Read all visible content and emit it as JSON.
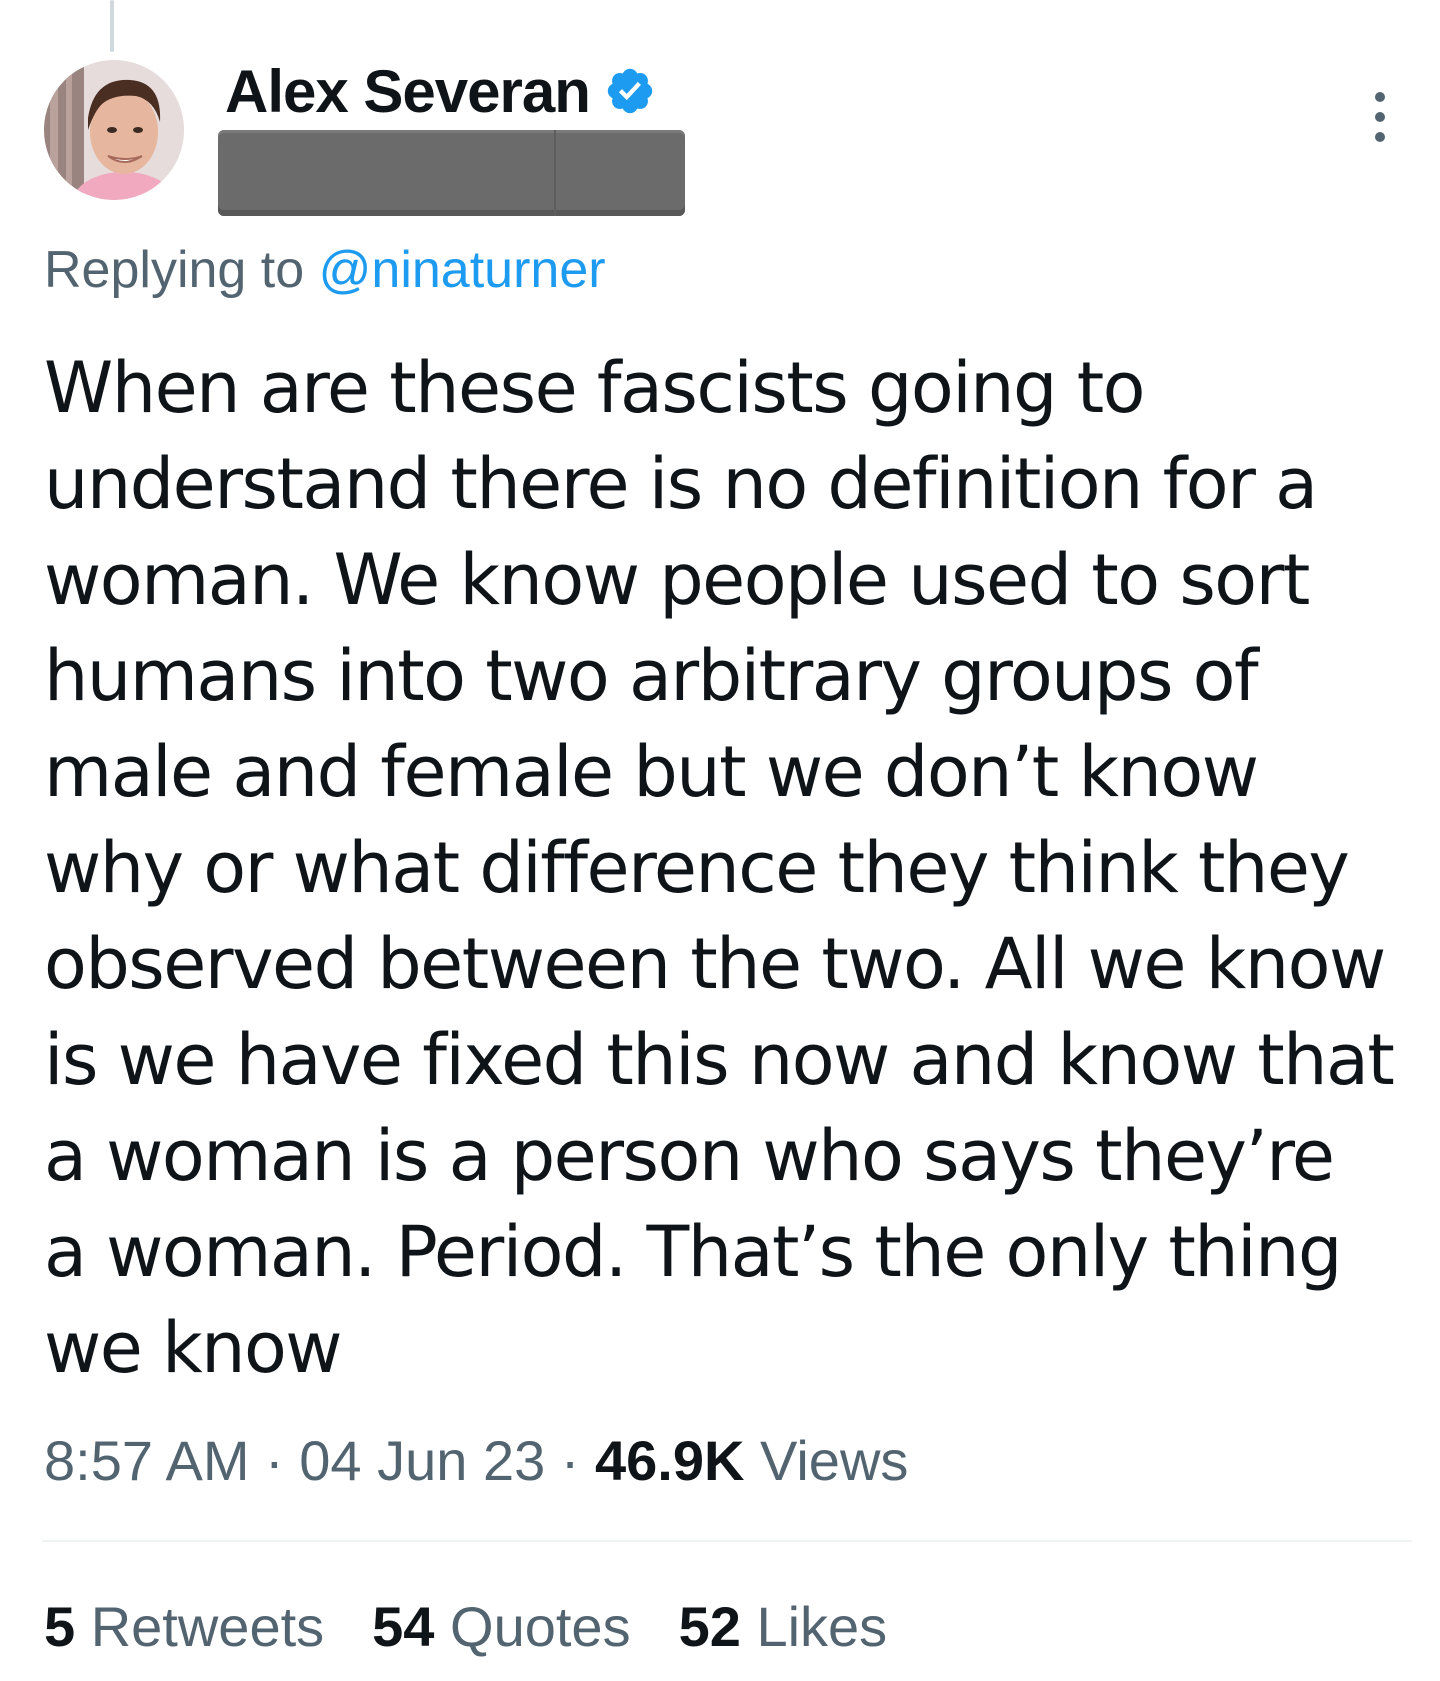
{
  "tweet": {
    "author": {
      "display_name": "Alex Severan",
      "verified": true,
      "handle_redacted": true
    },
    "reply": {
      "prefix": "Replying to",
      "mention": "@ninaturner"
    },
    "text_lines": [
      "When are these fascists going to",
      "understand there is no definition for a",
      "woman.  We know people used to sort",
      "humans into two arbitrary groups of",
      "male and female but we don’t know",
      "why or what difference they think they",
      "observed between the two.  All we know",
      "is we have fixed this now and know that",
      "a woman is a person who says they’re",
      "a woman.  Period.  That’s the only thing",
      "we know"
    ],
    "meta": {
      "time": "8:57 AM",
      "separator": "·",
      "date": "04 Jun 23",
      "views_count": "46.9K",
      "views_label": "Views"
    },
    "stats": {
      "retweets_count": "5",
      "retweets_label": "Retweets",
      "quotes_count": "54",
      "quotes_label": "Quotes",
      "likes_count": "52",
      "likes_label": "Likes"
    }
  },
  "icons": {
    "verified": "verified-badge-icon",
    "more": "more-options-icon"
  },
  "colors": {
    "text_primary": "#0f1419",
    "text_secondary": "#536471",
    "accent": "#1d9bf0",
    "divider": "#eff3f4",
    "redaction": "#6b6b6b"
  }
}
